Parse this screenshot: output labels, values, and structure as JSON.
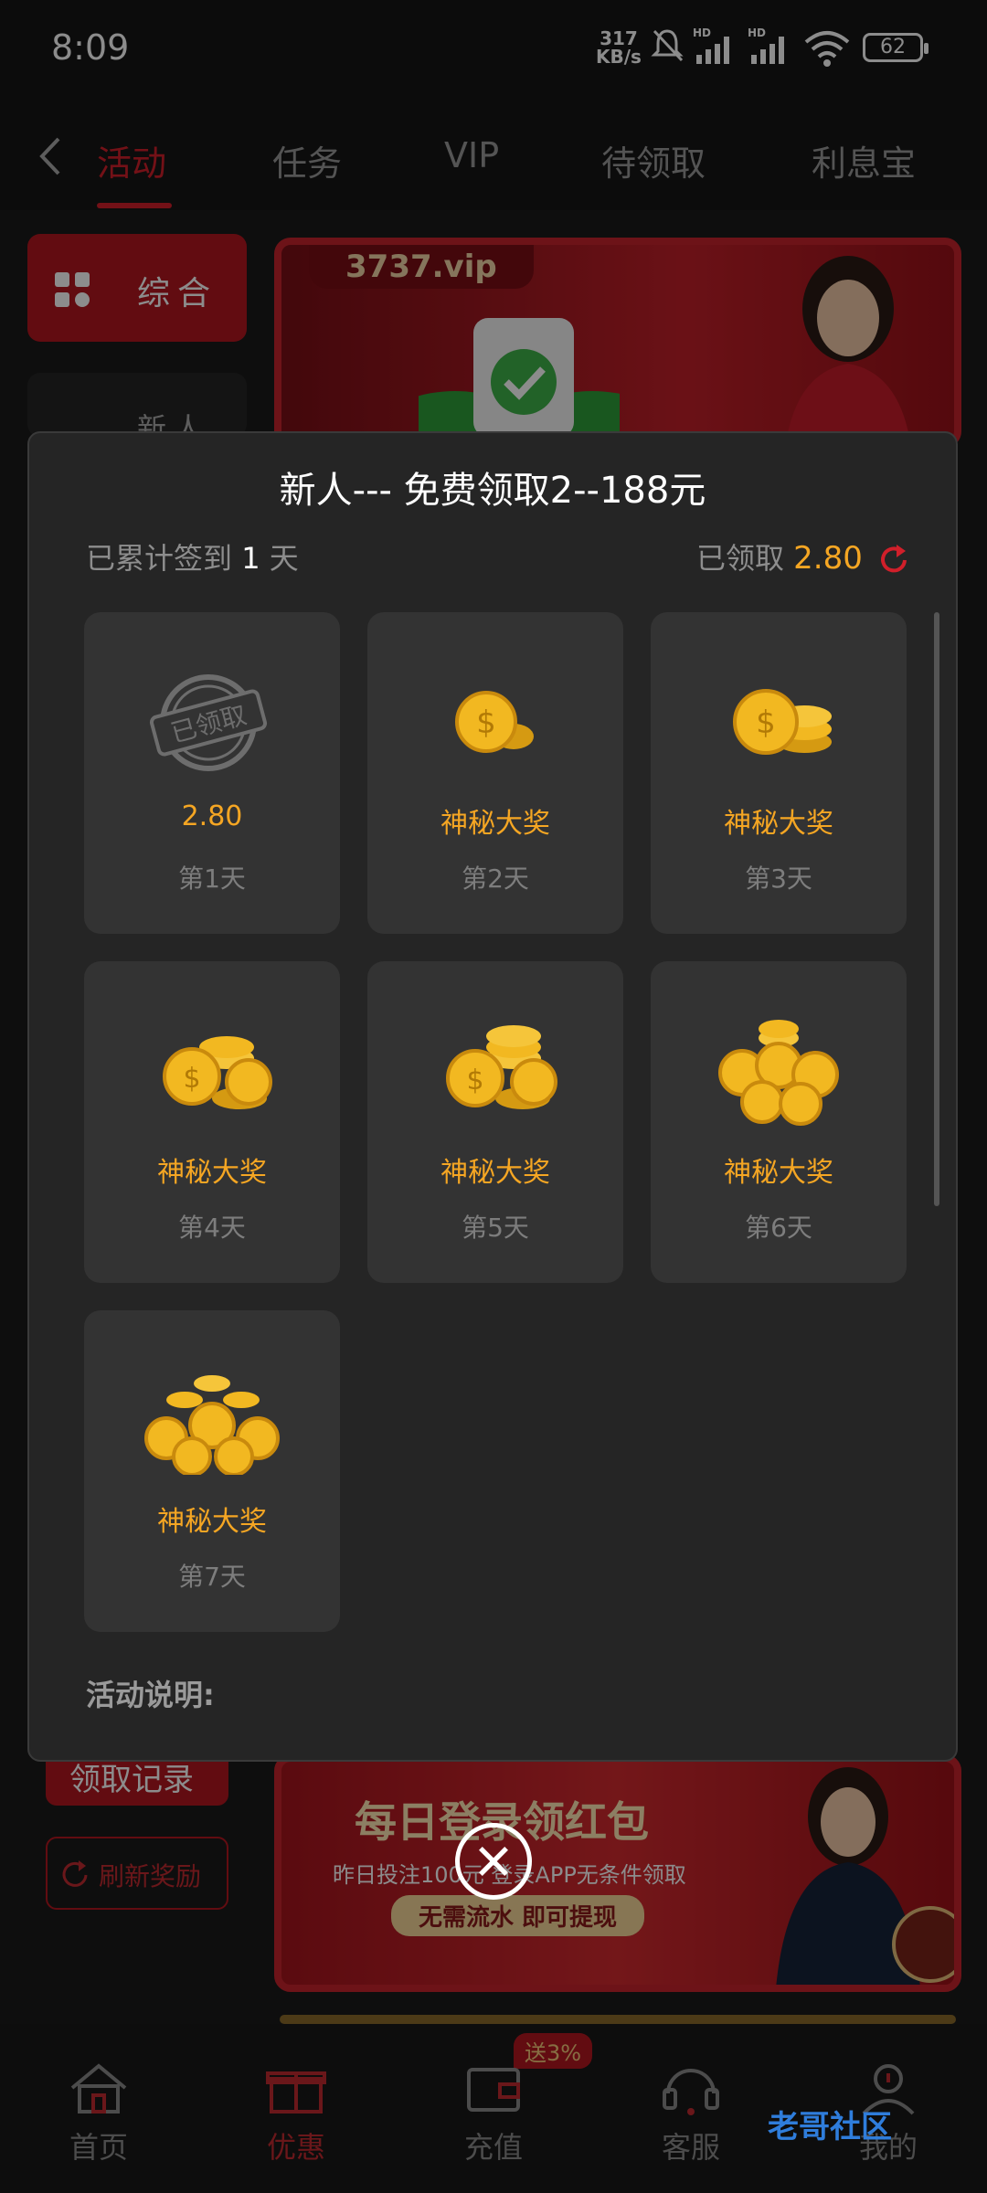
{
  "status_bar": {
    "time": "8:09",
    "net_speed": "317",
    "net_unit": "KB/s",
    "battery": "62"
  },
  "top_tabs": [
    "活动",
    "任务",
    "VIP",
    "待领取",
    "利息宝"
  ],
  "sidebar": {
    "general": "综合",
    "newbie": "新人"
  },
  "banner1": {
    "site": "3737.vip"
  },
  "banner2": {
    "title": "每日登录领红包",
    "subtitle": "昨日投注100元 登录APP无条件领取",
    "pill": "无需流水 即可提现"
  },
  "side_buttons": {
    "records": "领取记录",
    "refresh": "刷新奖励"
  },
  "modal": {
    "title": "新人--- 免费领取2--188元",
    "signed_prefix": "已累计签到",
    "signed_days": "1",
    "signed_suffix": "天",
    "claimed_label": "已领取",
    "claimed_amount": "2.80",
    "description_label": "活动说明:",
    "stamp_text": "已领取",
    "cards": [
      {
        "value": "2.80",
        "day": "第1天",
        "claimed": true
      },
      {
        "value": "神秘大奖",
        "day": "第2天",
        "claimed": false
      },
      {
        "value": "神秘大奖",
        "day": "第3天",
        "claimed": false
      },
      {
        "value": "神秘大奖",
        "day": "第4天",
        "claimed": false
      },
      {
        "value": "神秘大奖",
        "day": "第5天",
        "claimed": false
      },
      {
        "value": "神秘大奖",
        "day": "第6天",
        "claimed": false
      },
      {
        "value": "神秘大奖",
        "day": "第7天",
        "claimed": false
      }
    ]
  },
  "bottom_nav": {
    "items": [
      "首页",
      "优惠",
      "充值",
      "客服",
      "我的"
    ],
    "badge": "送3%"
  },
  "watermark": "老哥社区",
  "colors": {
    "accent": "#d11f2a",
    "gold": "#f5a623"
  }
}
